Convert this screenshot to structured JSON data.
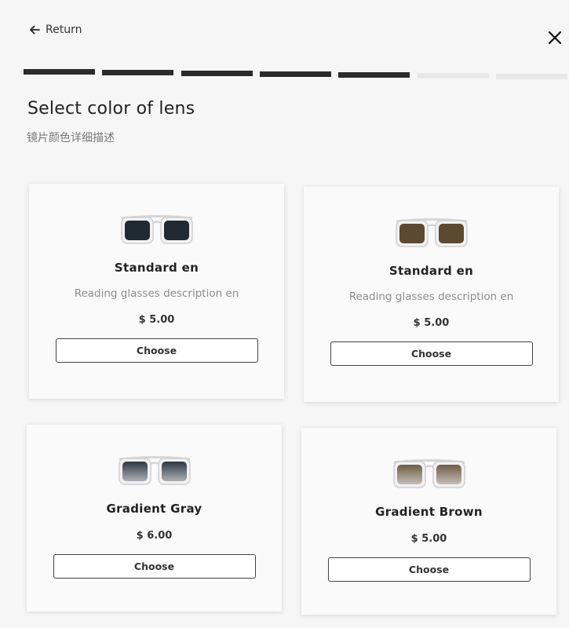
{
  "nav": {
    "return_label": "Return",
    "return_icon": "arrow-left-icon",
    "close_icon": "close-icon"
  },
  "progress": {
    "completed_steps": 5,
    "total_steps": 7,
    "colors": {
      "completed": "#2b2b2b",
      "remaining": "#e8e8e8"
    }
  },
  "header": {
    "title": "Select color of lens",
    "subtitle": "镜片颜色详细描述"
  },
  "options": [
    {
      "name": "Standard en",
      "description": "Reading glasses description en",
      "price": "$ 5.00",
      "button_label": "Choose",
      "lens_color": "#1f2a33",
      "lens_style": "solid"
    },
    {
      "name": "Standard en",
      "description": "Reading glasses description en",
      "price": "$ 5.00",
      "button_label": "Choose",
      "lens_color": "#5a4a30",
      "lens_style": "solid"
    },
    {
      "name": "Gradient Gray",
      "price": "$ 6.00",
      "button_label": "Choose",
      "lens_color": "#2c3742",
      "lens_style": "gradient"
    },
    {
      "name": "Gradient Brown",
      "price": "$ 5.00",
      "button_label": "Choose",
      "lens_color": "#6e5d45",
      "lens_style": "gradient"
    }
  ]
}
